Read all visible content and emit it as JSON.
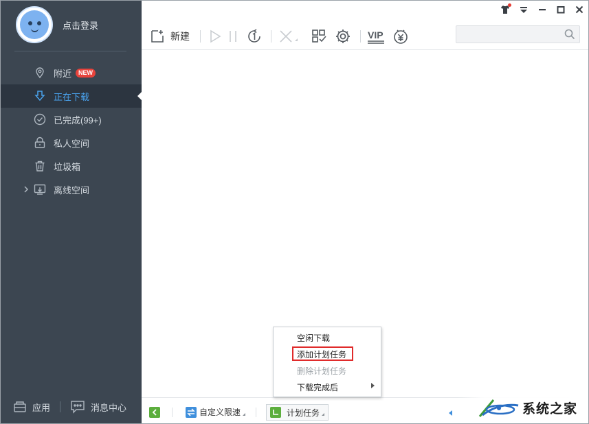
{
  "sidebar": {
    "login_label": "点击登录",
    "items": [
      {
        "id": "nearby",
        "label": "附近",
        "badge": "NEW",
        "icon": "location-pin-icon"
      },
      {
        "id": "downloading",
        "label": "正在下载",
        "icon": "download-arrow-icon",
        "active": true
      },
      {
        "id": "completed",
        "label": "已完成(99+)",
        "icon": "check-circle-icon"
      },
      {
        "id": "private",
        "label": "私人空间",
        "icon": "lock-icon"
      },
      {
        "id": "trash",
        "label": "垃圾箱",
        "icon": "trash-icon"
      },
      {
        "id": "offline",
        "label": "离线空间",
        "icon": "cloud-download-icon"
      }
    ],
    "bottom": {
      "apps_label": "应用",
      "messages_label": "消息中心"
    }
  },
  "toolbar": {
    "new_label": "新建",
    "vip_label": "VIP",
    "search_placeholder": ""
  },
  "statusbar": {
    "speed_label": "自定义限速",
    "schedule_label": "计划任务"
  },
  "context_menu": {
    "items": [
      {
        "label": "空闲下载",
        "enabled": true
      },
      {
        "label": "添加计划任务",
        "enabled": true,
        "highlighted": true
      },
      {
        "label": "删除计划任务",
        "enabled": false
      },
      {
        "label": "下载完成后",
        "enabled": true,
        "submenu": true
      }
    ]
  },
  "watermark": {
    "text": "系统之家"
  },
  "colors": {
    "sidebar_bg": "#3c4651",
    "accent": "#4aa3ee",
    "badge": "#e8433c",
    "highlight_border": "#e02b2b",
    "green": "#5cae3d"
  }
}
